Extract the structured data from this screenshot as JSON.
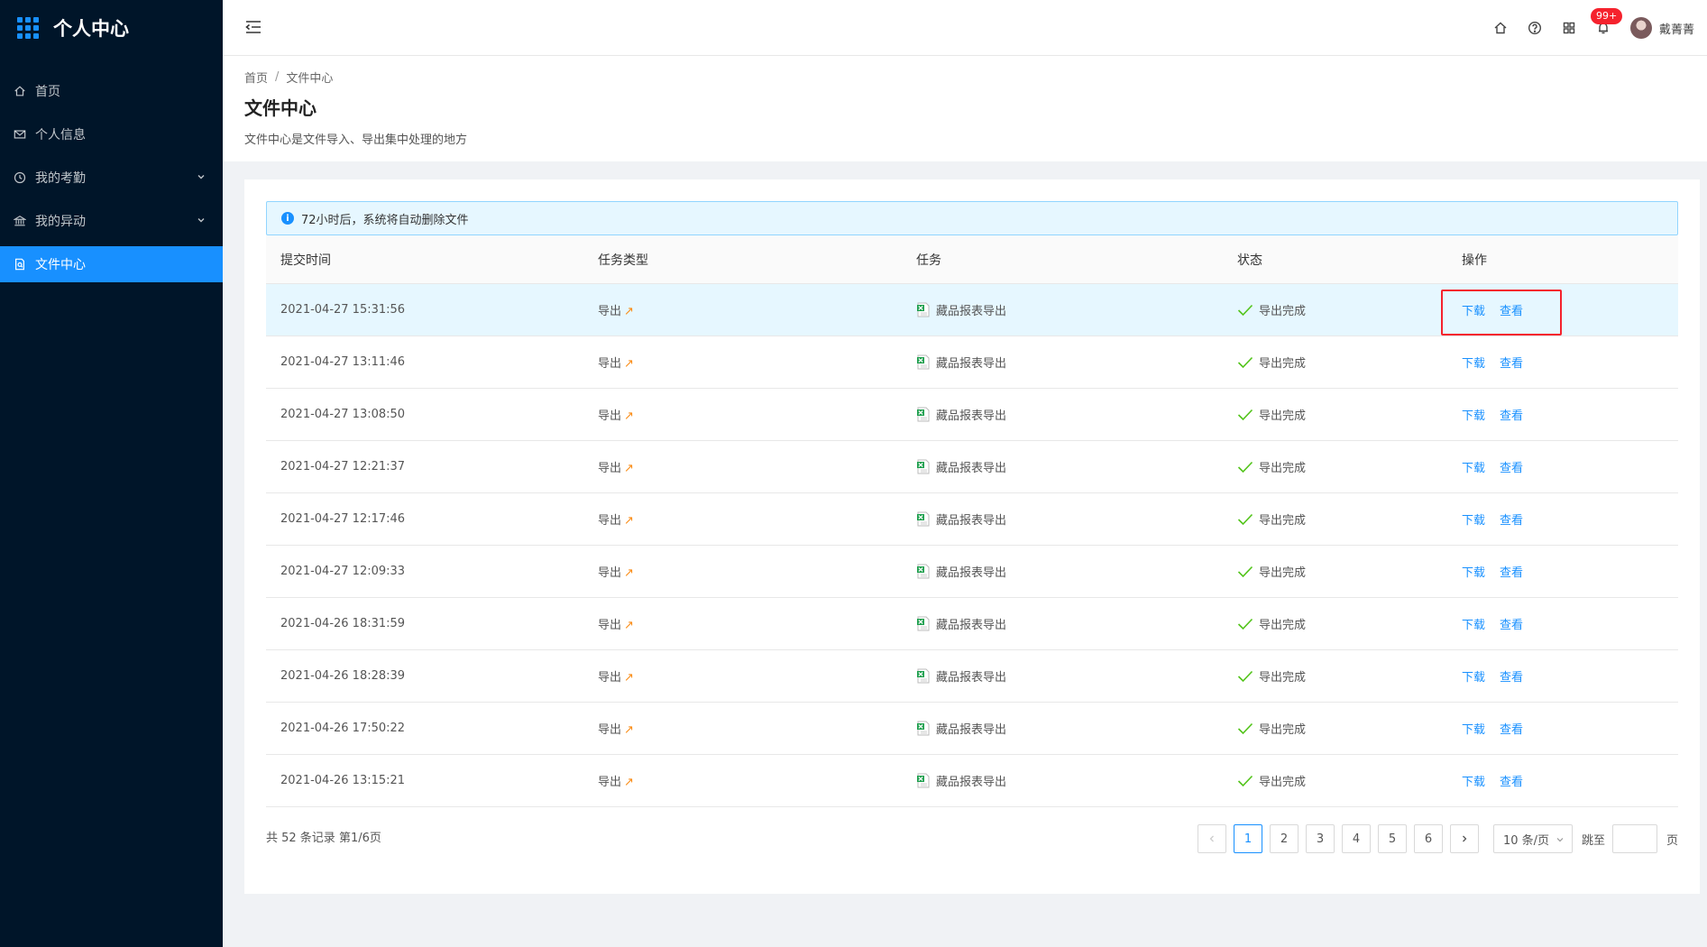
{
  "app": {
    "title": "个人中心"
  },
  "sidebar": {
    "items": [
      {
        "label": "首页",
        "icon": "home-icon"
      },
      {
        "label": "个人信息",
        "icon": "mail-icon"
      },
      {
        "label": "我的考勤",
        "icon": "clock-icon",
        "has_children": true
      },
      {
        "label": "我的异动",
        "icon": "bank-icon",
        "has_children": true
      },
      {
        "label": "文件中心",
        "icon": "file-icon",
        "active": true
      }
    ]
  },
  "header": {
    "badge": "99+",
    "username": "戴菁菁"
  },
  "breadcrumb": {
    "home": "首页",
    "sep": "/",
    "current": "文件中心"
  },
  "page": {
    "title": "文件中心",
    "description": "文件中心是文件导入、导出集中处理的地方"
  },
  "alert": {
    "text": "72小时后，系统将自动删除文件"
  },
  "table": {
    "headers": {
      "time": "提交时间",
      "type": "任务类型",
      "task": "任务",
      "status": "状态",
      "ops": "操作"
    },
    "rows": [
      {
        "time": "2021-04-27 15:31:56",
        "type": "导出",
        "task": "藏品报表导出",
        "status": "导出完成"
      },
      {
        "time": "2021-04-27 13:11:46",
        "type": "导出",
        "task": "藏品报表导出",
        "status": "导出完成"
      },
      {
        "time": "2021-04-27 13:08:50",
        "type": "导出",
        "task": "藏品报表导出",
        "status": "导出完成"
      },
      {
        "time": "2021-04-27 12:21:37",
        "type": "导出",
        "task": "藏品报表导出",
        "status": "导出完成"
      },
      {
        "time": "2021-04-27 12:17:46",
        "type": "导出",
        "task": "藏品报表导出",
        "status": "导出完成"
      },
      {
        "time": "2021-04-27 12:09:33",
        "type": "导出",
        "task": "藏品报表导出",
        "status": "导出完成"
      },
      {
        "time": "2021-04-26 18:31:59",
        "type": "导出",
        "task": "藏品报表导出",
        "status": "导出完成"
      },
      {
        "time": "2021-04-26 18:28:39",
        "type": "导出",
        "task": "藏品报表导出",
        "status": "导出完成"
      },
      {
        "time": "2021-04-26 17:50:22",
        "type": "导出",
        "task": "藏品报表导出",
        "status": "导出完成"
      },
      {
        "time": "2021-04-26 13:15:21",
        "type": "导出",
        "task": "藏品报表导出",
        "status": "导出完成"
      }
    ],
    "actions": {
      "download": "下载",
      "view": "查看"
    }
  },
  "pagination": {
    "total_text": "共 52 条记录 第1/6页",
    "pages": [
      "1",
      "2",
      "3",
      "4",
      "5",
      "6"
    ],
    "current": "1",
    "page_size": "10 条/页",
    "jump_label": "跳至",
    "page_label": "页"
  },
  "colors": {
    "sidebar_bg": "#001529",
    "primary": "#1890ff",
    "success": "#52c41a",
    "badge": "#f5222d",
    "highlight_box": "#f5222d"
  }
}
